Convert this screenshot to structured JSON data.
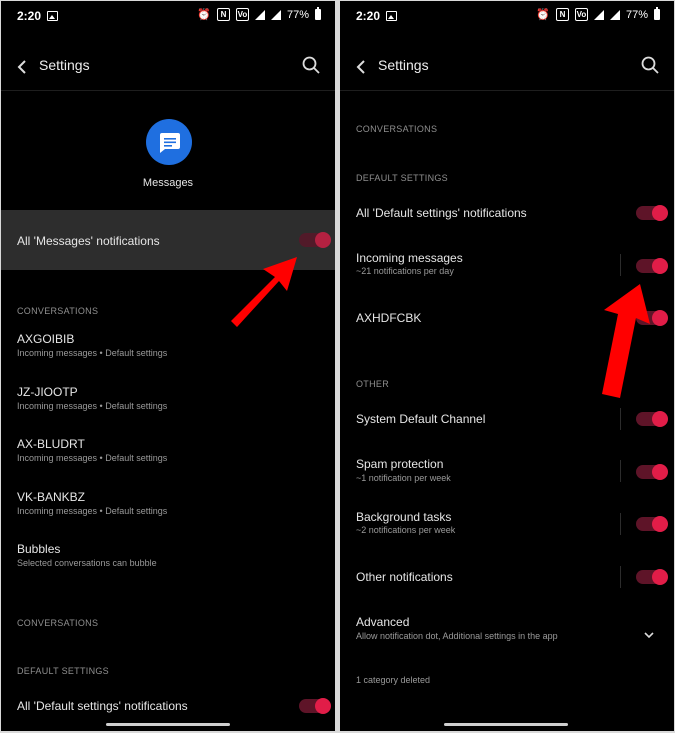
{
  "status_bar": {
    "time": "2:20",
    "battery_pct": "77%",
    "nfc": "N",
    "volte": "Vo"
  },
  "app_bar": {
    "title": "Settings"
  },
  "left": {
    "app_name": "Messages",
    "all_notifications_label": "All 'Messages' notifications",
    "conversations_header": "CONVERSATIONS",
    "conversations": [
      {
        "title": "AXGOIBIB",
        "subtitle": "Incoming messages • Default settings"
      },
      {
        "title": "JZ-JIOOTP",
        "subtitle": "Incoming messages • Default settings"
      },
      {
        "title": "AX-BLUDRT",
        "subtitle": "Incoming messages • Default settings"
      },
      {
        "title": "VK-BANKBZ",
        "subtitle": "Incoming messages • Default settings"
      }
    ],
    "bubbles": {
      "title": "Bubbles",
      "subtitle": "Selected conversations can bubble"
    },
    "conversations_header_2": "CONVERSATIONS",
    "default_settings_header": "DEFAULT SETTINGS",
    "default_all_label": "All 'Default settings' notifications"
  },
  "right": {
    "conversations_header": "CONVERSATIONS",
    "default_settings_header": "DEFAULT SETTINGS",
    "default_all_label": "All 'Default settings' notifications",
    "incoming": {
      "title": "Incoming messages",
      "subtitle": "~21 notifications per day"
    },
    "axhdfcbk": {
      "title": "AXHDFCBK"
    },
    "other_header": "OTHER",
    "system_default": {
      "title": "System Default Channel"
    },
    "spam": {
      "title": "Spam protection",
      "subtitle": "~1 notification per week"
    },
    "background": {
      "title": "Background tasks",
      "subtitle": "~2 notifications per week"
    },
    "other_notifications": {
      "title": "Other notifications"
    },
    "advanced": {
      "title": "Advanced",
      "subtitle": "Allow notification dot, Additional settings in the app"
    },
    "deleted": "1 category deleted"
  },
  "colors": {
    "accent": "#e11d48",
    "toggle_track": "#5e1428",
    "app_icon": "#1f6fe0",
    "highlight": "#2d2d2d",
    "arrow": "#ff0000"
  }
}
